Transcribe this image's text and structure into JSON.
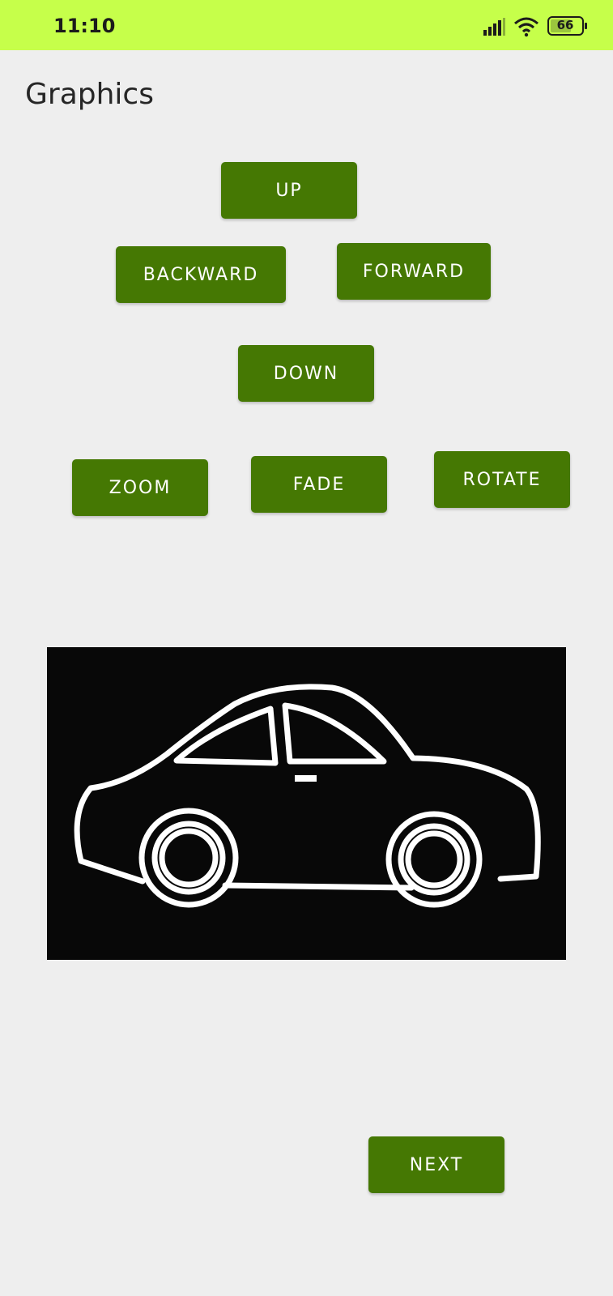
{
  "status_bar": {
    "time": "11:10",
    "battery_level": "66",
    "icons": [
      "signal-icon",
      "wifi-icon",
      "battery-icon"
    ],
    "background_color": "#c6ff4a"
  },
  "header": {
    "title": "Graphics"
  },
  "controls": {
    "up_label": "UP",
    "backward_label": "BACKWARD",
    "forward_label": "FORWARD",
    "down_label": "DOWN",
    "zoom_label": "ZOOM",
    "fade_label": "FADE",
    "rotate_label": "ROTATE"
  },
  "image": {
    "subject": "car-outline-icon",
    "background_color": "#080808"
  },
  "footer": {
    "next_label": "NEXT"
  },
  "colors": {
    "button_background": "#457803",
    "button_text": "#ffffff",
    "page_background": "#eeeeee"
  }
}
